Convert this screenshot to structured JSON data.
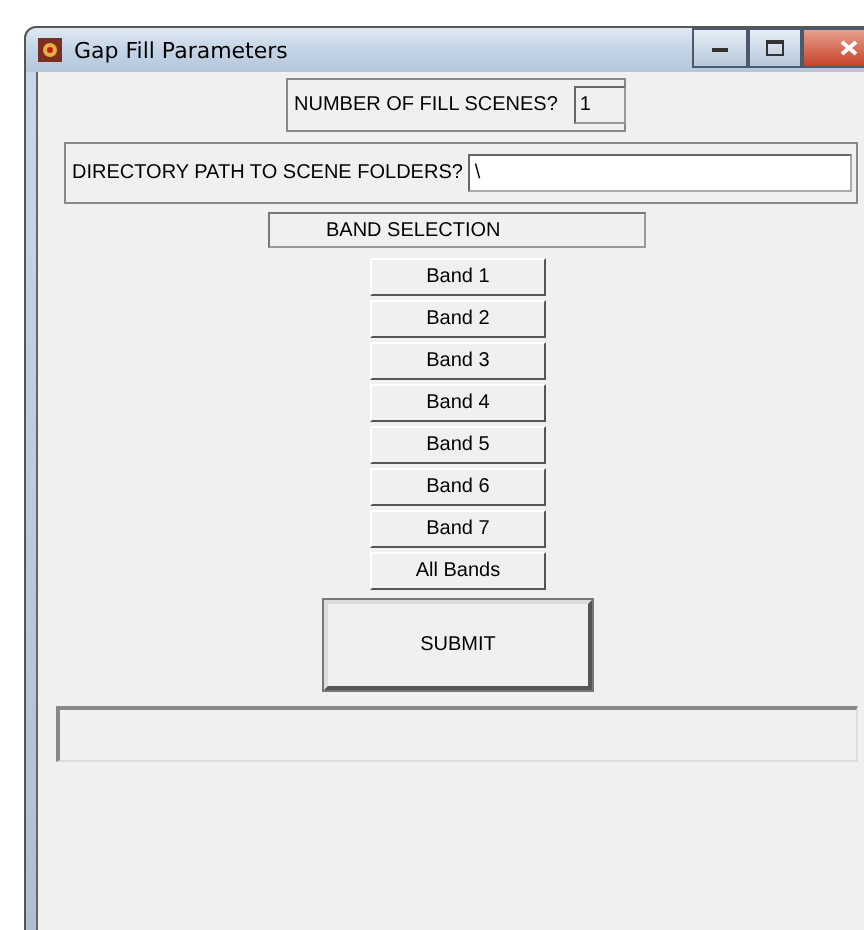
{
  "window": {
    "title": "Gap Fill Parameters"
  },
  "fill_scenes": {
    "label": "NUMBER OF FILL SCENES?",
    "value": "1"
  },
  "directory": {
    "label": "DIRECTORY PATH TO SCENE FOLDERS?",
    "value": "\\"
  },
  "band_selection": {
    "label": "BAND SELECTION"
  },
  "bands": [
    "Band 1",
    "Band 2",
    "Band 3",
    "Band 4",
    "Band 5",
    "Band 6",
    "Band 7",
    "All Bands"
  ],
  "submit": {
    "label": "SUBMIT"
  }
}
